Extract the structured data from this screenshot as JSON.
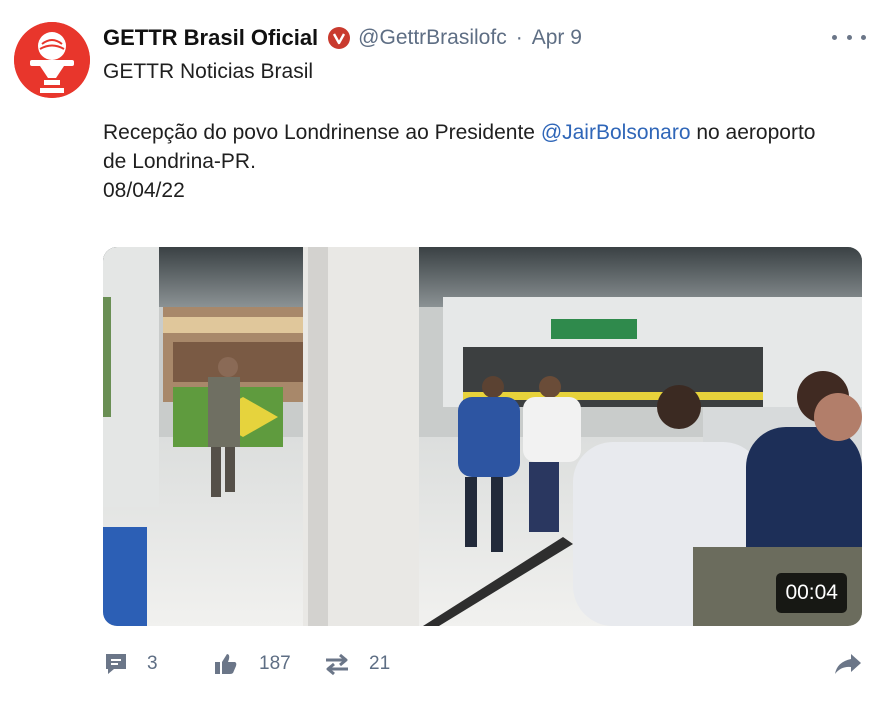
{
  "post": {
    "author_name": "GETTR Brasil Oficial",
    "handle": "@GettrBrasilofc",
    "separator": "·",
    "date": "Apr 9",
    "subtitle": "GETTR Noticias Brasil",
    "text_before_mention": "Recepção do povo Londrinense ao Presidente ",
    "mention": "@JairBolsonaro",
    "text_after_mention": " no aeroporto de Londrina-PR.",
    "date_line": "08/04/22",
    "video_duration": "00:04",
    "verified_badge": "V"
  },
  "actions": {
    "comments": "3",
    "likes": "187",
    "reposts": "21"
  },
  "icons": {
    "comment": "comment-icon",
    "like": "thumbs-up-icon",
    "repost": "repost-icon",
    "share": "share-icon",
    "more": "more-icon"
  },
  "colors": {
    "brand_red": "#e8362c",
    "mention_blue": "#2f66b8",
    "meta_gray": "#5e6e84"
  }
}
